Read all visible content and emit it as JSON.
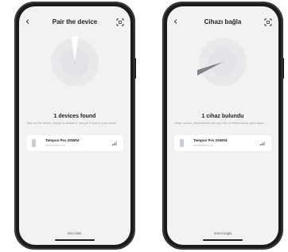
{
  "screens": [
    {
      "back_glyph": "‹",
      "title": "Pair the device",
      "found_text": "1 devices found",
      "hint_text": "Take out the device, charge to activate it, and put it close to your phone",
      "device": {
        "name": "Tempus Pro 2SW04",
        "mac": "F4:00:49:80:07:C0"
      },
      "bottom_link": "Bind later",
      "icons": {
        "back": "back-chevron-icon",
        "scan": "scan-icon",
        "device": "watch-icon",
        "signal": "signal-icon"
      }
    },
    {
      "back_glyph": "‹",
      "title": "Cihazı bağla",
      "found_text": "1 cihaz bulundu",
      "hint_text": "Cihazı çıkarın, etkinleştirmek için şarj edin ve telefonunuza yakın tutun.",
      "device": {
        "name": "Tempus Pro 2SW04",
        "mac": "F4:00:49:80:07:C0"
      },
      "bottom_link": "Sonra bağla",
      "icons": {
        "back": "back-chevron-icon",
        "scan": "scan-icon",
        "device": "watch-icon",
        "signal": "signal-icon"
      }
    }
  ],
  "colors": {
    "screen_bg": "#f2f2f4",
    "card_bg": "#ffffff",
    "text": "#222222",
    "muted": "#9a9a9a"
  }
}
